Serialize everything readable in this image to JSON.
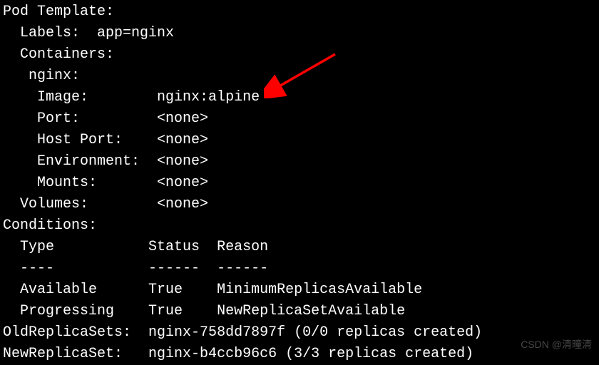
{
  "pod_template": {
    "heading": "Pod Template:",
    "labels_key": "  Labels:  ",
    "labels_value": "app=nginx",
    "containers_heading": "  Containers:",
    "container_name": "   nginx:",
    "image_key": "    Image:        ",
    "image_value": "nginx:alpine",
    "port_key": "    Port:         ",
    "port_value": "<none>",
    "hostport_key": "    Host Port:    ",
    "hostport_value": "<none>",
    "env_key": "    Environment:  ",
    "env_value": "<none>",
    "mounts_key": "    Mounts:       ",
    "mounts_value": "<none>",
    "volumes_key": "  Volumes:        ",
    "volumes_value": "<none>"
  },
  "conditions": {
    "heading": "Conditions:",
    "header_type": "  Type           ",
    "header_status": "Status  ",
    "header_reason": "Reason",
    "sep_type": "  ----           ",
    "sep_status": "------  ",
    "sep_reason": "------",
    "row1_type": "  Available      ",
    "row1_status": "True    ",
    "row1_reason": "MinimumReplicasAvailable",
    "row2_type": "  Progressing    ",
    "row2_status": "True    ",
    "row2_reason": "NewReplicaSetAvailable"
  },
  "replicasets": {
    "old_key": "OldReplicaSets:  ",
    "old_value": "nginx-758dd7897f (0/0 replicas created)",
    "new_key": "NewReplicaSet:   ",
    "new_value": "nginx-b4ccb96c6 (3/3 replicas created)"
  },
  "watermark": "CSDN @清曈清"
}
